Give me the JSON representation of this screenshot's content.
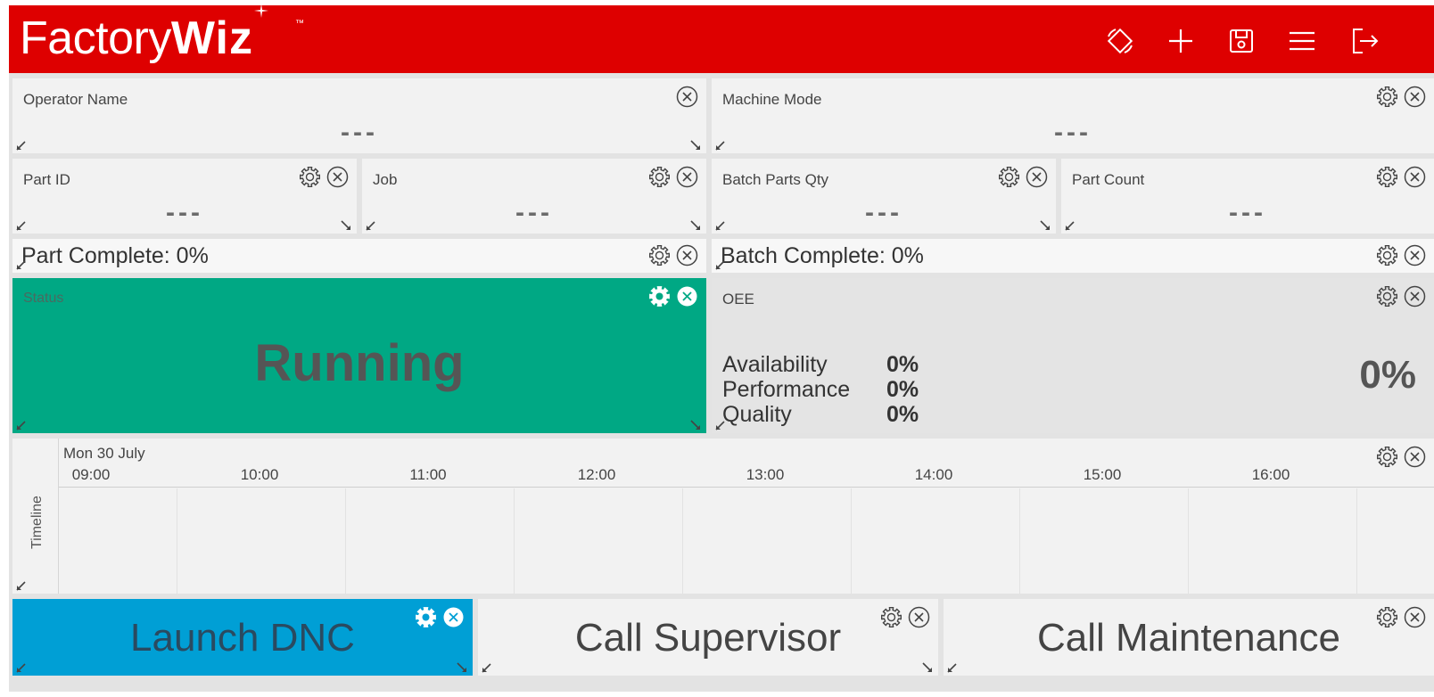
{
  "header": {
    "logo_light": "Factory",
    "logo_bold": "Wiz",
    "logo_tm": "™",
    "toolbar": [
      "rotate-icon",
      "add-icon",
      "save-icon",
      "menu-icon",
      "logout-icon"
    ]
  },
  "colors": {
    "brand": "#de0000",
    "status_running": "#00a884",
    "dnc": "#009fd5"
  },
  "tiles": {
    "operator": {
      "title": "Operator Name",
      "value": "---"
    },
    "machine_mode": {
      "title": "Machine Mode",
      "value": "---"
    },
    "part_id": {
      "title": "Part ID",
      "value": "---"
    },
    "job": {
      "title": "Job",
      "value": "---"
    },
    "batch_qty": {
      "title": "Batch Parts Qty",
      "value": "---"
    },
    "part_count": {
      "title": "Part Count",
      "value": "---"
    },
    "part_complete": {
      "label": "Part Complete: 0%",
      "percent": 0
    },
    "batch_complete": {
      "label": "Batch Complete: 0%",
      "percent": 0
    },
    "status": {
      "title": "Status",
      "value": "Running"
    },
    "oee": {
      "title": "OEE",
      "availability_label": "Availability",
      "availability": "0%",
      "performance_label": "Performance",
      "performance": "0%",
      "quality_label": "Quality",
      "quality": "0%",
      "total": "0%"
    },
    "timeline": {
      "label": "Timeline",
      "date": "Mon 30 July",
      "hours": [
        "09:00",
        "10:00",
        "11:00",
        "12:00",
        "13:00",
        "14:00",
        "15:00",
        "16:00"
      ]
    },
    "actions": {
      "dnc": "Launch DNC",
      "supervisor": "Call Supervisor",
      "maintenance": "Call Maintenance"
    }
  }
}
